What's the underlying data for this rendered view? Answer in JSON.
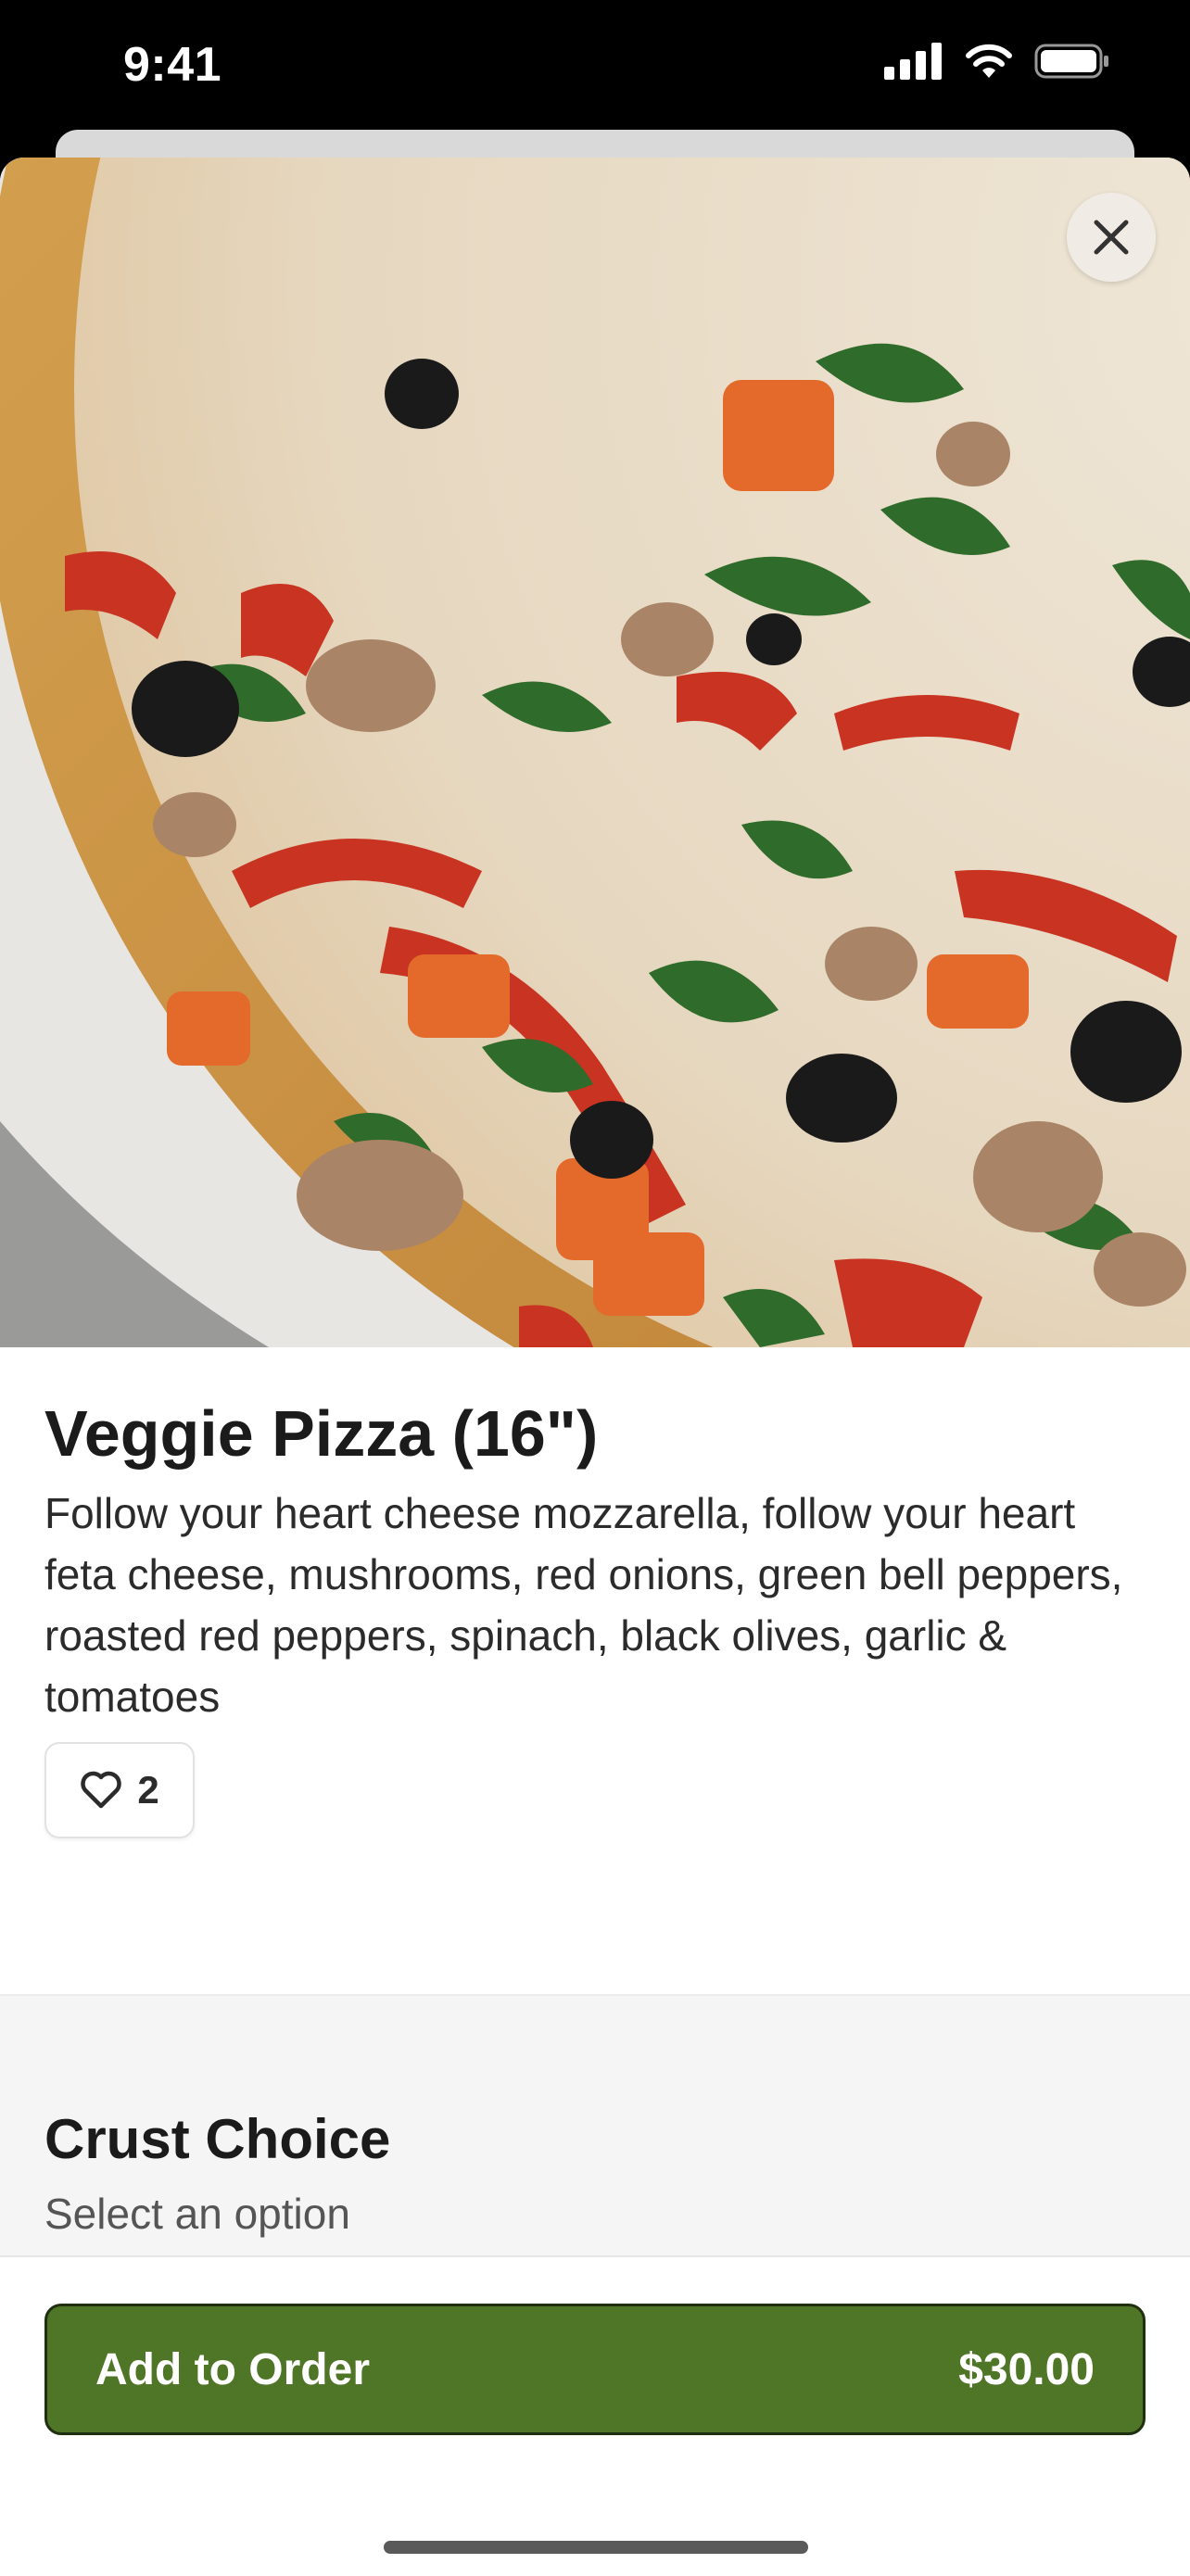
{
  "status_bar": {
    "time": "9:41"
  },
  "item": {
    "title": "Veggie Pizza (16\")",
    "description": "Follow your heart cheese mozzarella, follow your heart feta cheese, mushrooms, red onions, green bell peppers, roasted red peppers, spinach, black olives, garlic & tomatoes",
    "likes": "2",
    "image": "veggie-pizza-photo"
  },
  "options": {
    "title": "Crust Choice",
    "subtitle": "Select an option"
  },
  "footer": {
    "add_label": "Add to Order",
    "price": "$30.00"
  },
  "icons": {
    "close": "close-icon",
    "like": "heart-icon"
  },
  "colors": {
    "accent": "#4f7526"
  }
}
